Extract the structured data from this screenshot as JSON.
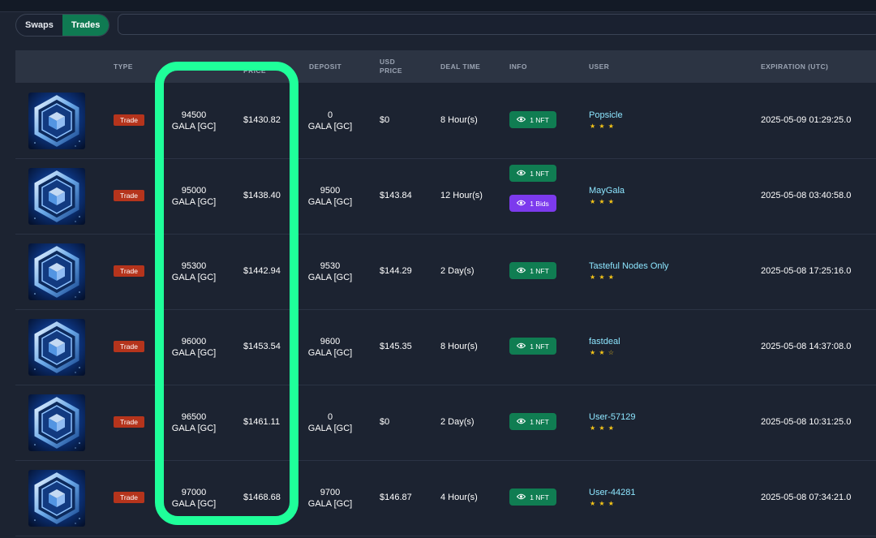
{
  "tabs": {
    "swaps": "Swaps",
    "trades": "Trades"
  },
  "columns": {
    "type": "TYPE",
    "price": "PRICE",
    "deposit": "DEPOSIT",
    "usd_price_1": "USD",
    "usd_price_2": "PRICE",
    "deal_time": "DEAL TIME",
    "info": "INFO",
    "user": "USER",
    "expiration": "EXPIRATION (UTC)"
  },
  "rows": [
    {
      "type": "Trade",
      "amount": "94500",
      "currency": "GALA [GC]",
      "price": "$1430.82",
      "deposit_amount": "0",
      "deposit_currency": "GALA [GC]",
      "usd_price": "$0",
      "deal_time": "8 Hour(s)",
      "nft": "1 NFT",
      "user": "Popsicle",
      "stars": "★ ★ ★",
      "expiration": "2025-05-09 01:29:25.0"
    },
    {
      "type": "Trade",
      "amount": "95000",
      "currency": "GALA [GC]",
      "price": "$1438.40",
      "deposit_amount": "9500",
      "deposit_currency": "GALA [GC]",
      "usd_price": "$143.84",
      "deal_time": "12 Hour(s)",
      "nft": "1 NFT",
      "bids": "1 Bids",
      "user": "MayGala",
      "stars": "★ ★ ★",
      "expiration": "2025-05-08 03:40:58.0"
    },
    {
      "type": "Trade",
      "amount": "95300",
      "currency": "GALA [GC]",
      "price": "$1442.94",
      "deposit_amount": "9530",
      "deposit_currency": "GALA [GC]",
      "usd_price": "$144.29",
      "deal_time": "2 Day(s)",
      "nft": "1 NFT",
      "user": "Tasteful Nodes Only",
      "stars": "★ ★ ★",
      "expiration": "2025-05-08 17:25:16.0"
    },
    {
      "type": "Trade",
      "amount": "96000",
      "currency": "GALA [GC]",
      "price": "$1453.54",
      "deposit_amount": "9600",
      "deposit_currency": "GALA [GC]",
      "usd_price": "$145.35",
      "deal_time": "8 Hour(s)",
      "nft": "1 NFT",
      "user": "fastdeal",
      "stars": "★ ★ ☆",
      "expiration": "2025-05-08 14:37:08.0"
    },
    {
      "type": "Trade",
      "amount": "96500",
      "currency": "GALA [GC]",
      "price": "$1461.11",
      "deposit_amount": "0",
      "deposit_currency": "GALA [GC]",
      "usd_price": "$0",
      "deal_time": "2 Day(s)",
      "nft": "1 NFT",
      "user": "User-57129",
      "stars": "★ ★ ★",
      "expiration": "2025-05-08 10:31:25.0"
    },
    {
      "type": "Trade",
      "amount": "97000",
      "currency": "GALA [GC]",
      "price": "$1468.68",
      "deposit_amount": "9700",
      "deposit_currency": "GALA [GC]",
      "usd_price": "$146.87",
      "deal_time": "4 Hour(s)",
      "nft": "1 NFT",
      "user": "User-44281",
      "stars": "★ ★ ★",
      "expiration": "2025-05-08 07:34:21.0"
    }
  ],
  "colors": {
    "accent_green": "#0f7a52",
    "highlight": "#1fff9a",
    "trade_badge": "#b5341c",
    "bids_purple": "#7c3aed",
    "user_link": "#8de6ff",
    "star": "#f5c518"
  },
  "icons": {
    "thumbnail": "node-cube-icon",
    "info": "eye-icon"
  }
}
